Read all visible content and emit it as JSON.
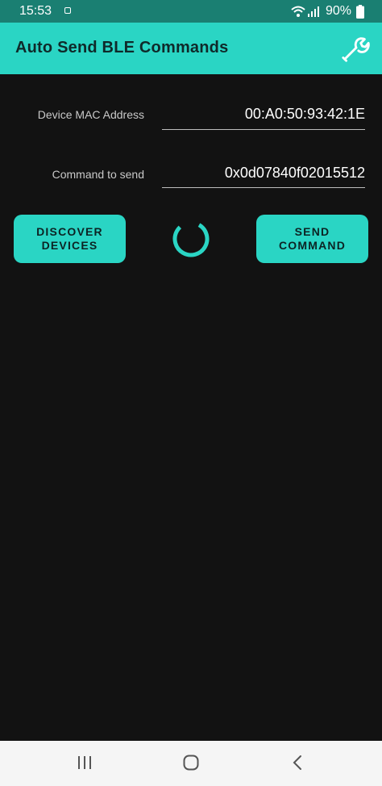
{
  "status": {
    "time": "15:53",
    "battery": "90%"
  },
  "app": {
    "title": "Auto Send BLE Commands"
  },
  "form": {
    "mac_label": "Device MAC Address",
    "mac_value": "00:A0:50:93:42:1E",
    "cmd_label": "Command to send",
    "cmd_value": "0x0d07840f02015512"
  },
  "buttons": {
    "discover_line1": "DISCOVER",
    "discover_line2": "DEVICES",
    "send_line1": "SEND",
    "send_line2": "COMMAND"
  },
  "icons": {
    "settings": "wrench-icon",
    "progress": "progress-spinner",
    "nav_recent": "recent-apps-icon",
    "nav_home": "home-icon",
    "nav_back": "back-icon"
  },
  "colors": {
    "accent": "#2ad5c4",
    "status_bar": "#1a7f72",
    "background": "#121212"
  }
}
